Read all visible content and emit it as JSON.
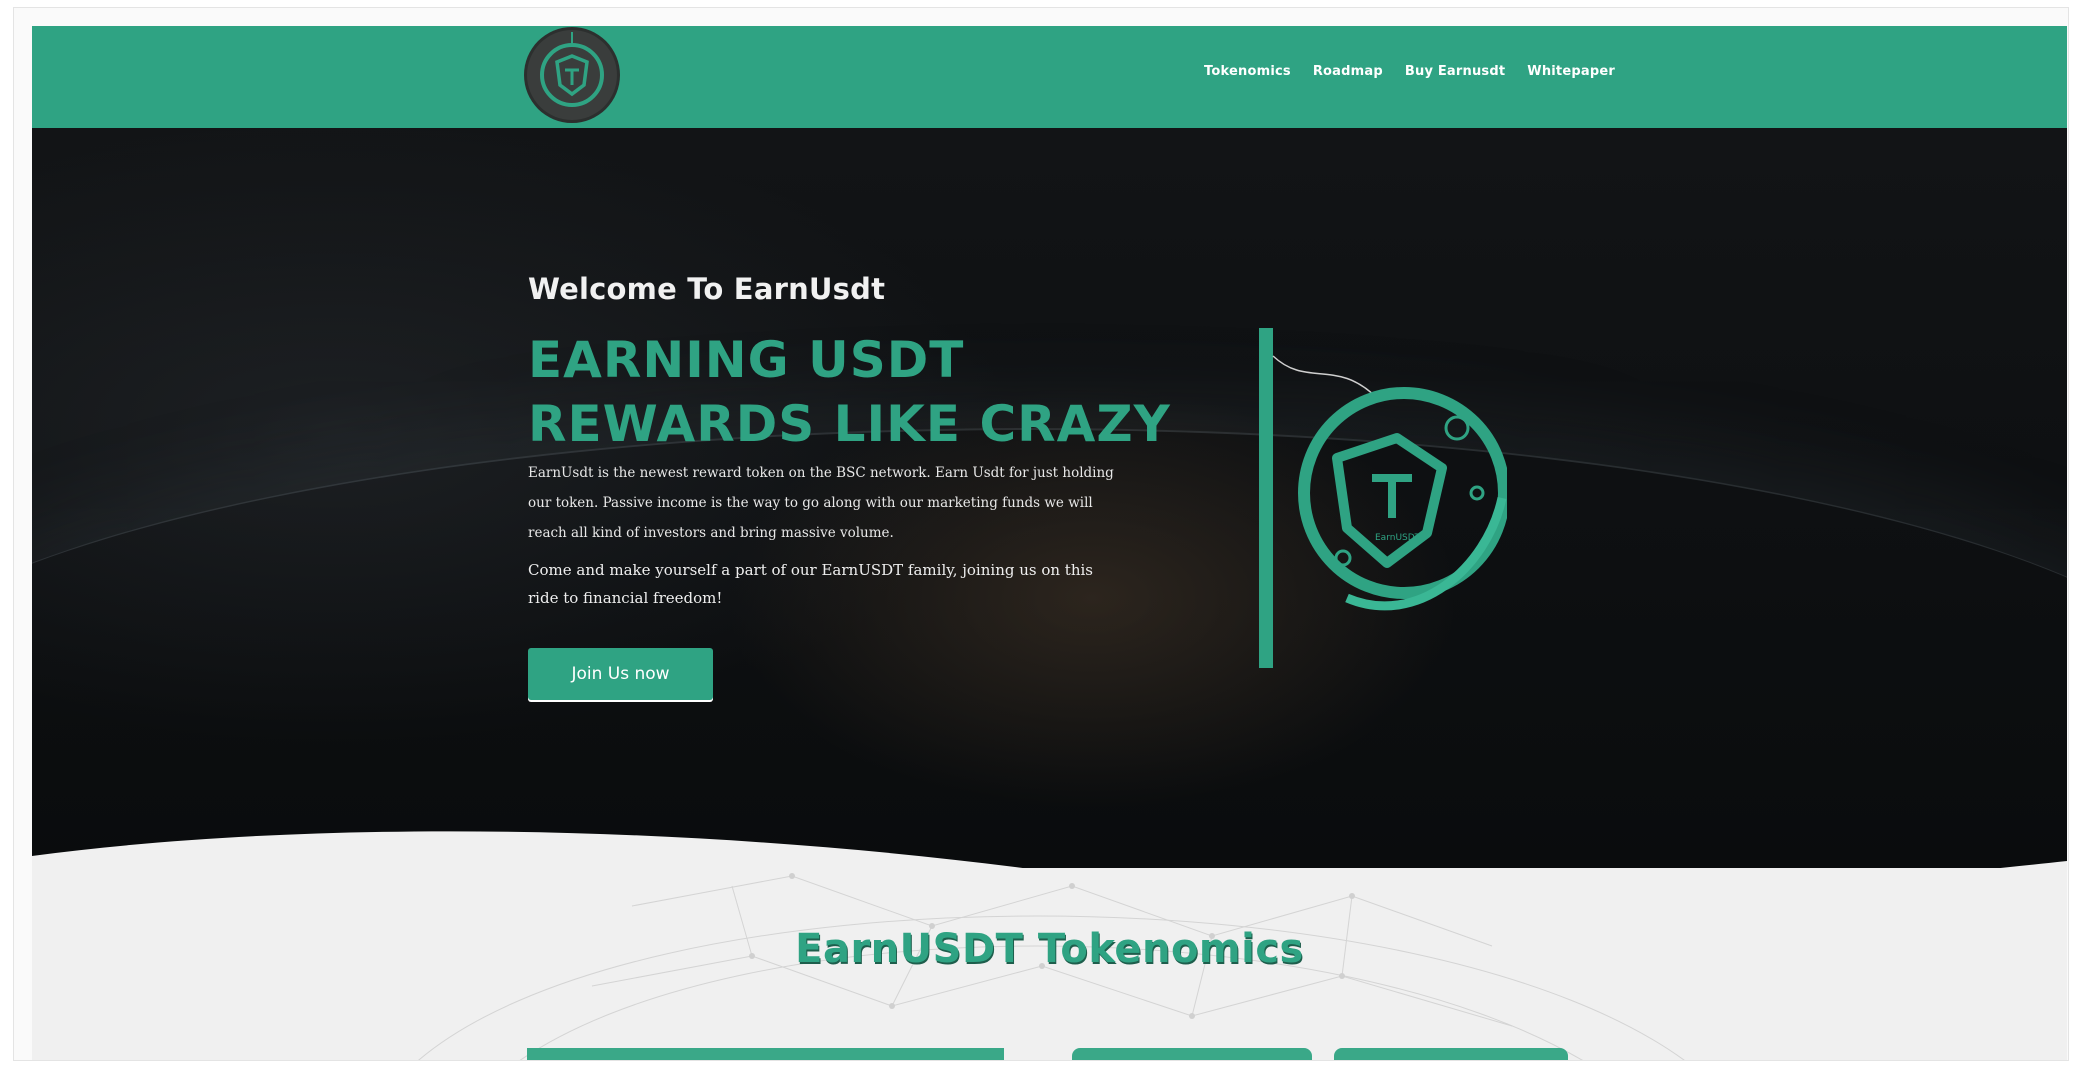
{
  "colors": {
    "brand": "#2fa383",
    "hero_bg": "#0d0f11",
    "light_bg": "#f0f0f0"
  },
  "header": {
    "logo_icon": "shield-t-logo-icon",
    "nav": [
      {
        "label": "Tokenomics"
      },
      {
        "label": "Roadmap"
      },
      {
        "label": "Buy Earnusdt"
      },
      {
        "label": "Whitepaper"
      }
    ]
  },
  "hero": {
    "welcome": "Welcome To EarnUsdt",
    "headline_line1": "EARNING USDT",
    "headline_line2": "REWARDS LIKE CRAZY",
    "description": "EarnUsdt is the newest reward token on the BSC network. Earn Usdt for just holding our token. Passive income is the way to go along with our marketing funds we will reach all kind of investors and bring massive volume.",
    "description2": "Come and make yourself a part of our EarnUSDT family, joining us on this ride to financial freedom!",
    "join_button": "Join Us now",
    "art_label": "EarnUSDT"
  },
  "tokenomics": {
    "title": "EarnUSDT Tokenomics"
  }
}
